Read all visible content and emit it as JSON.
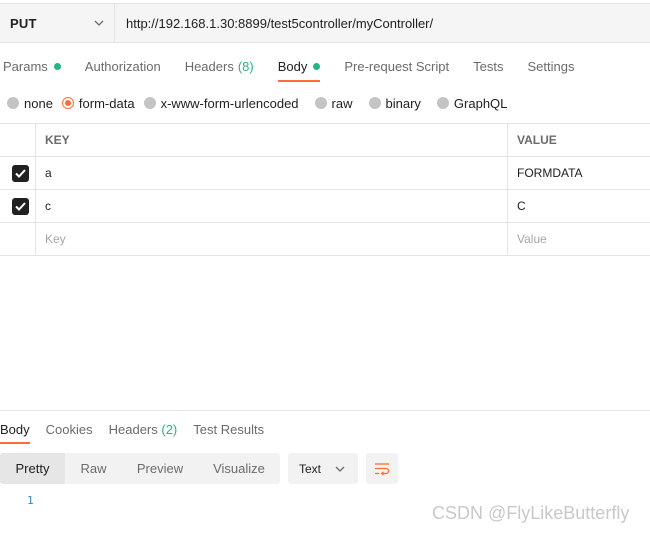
{
  "request": {
    "method": "PUT",
    "url": "http://192.168.1.30:8899/test5controller/myController/"
  },
  "tabs": [
    {
      "label": "Params",
      "dot": true
    },
    {
      "label": "Authorization"
    },
    {
      "label": "Headers",
      "count": "(8)"
    },
    {
      "label": "Body",
      "dot": true,
      "active": true
    },
    {
      "label": "Pre-request Script"
    },
    {
      "label": "Tests"
    },
    {
      "label": "Settings"
    }
  ],
  "body_types": [
    {
      "label": "none"
    },
    {
      "label": "form-data",
      "selected": true
    },
    {
      "label": "x-www-form-urlencoded"
    },
    {
      "label": "raw"
    },
    {
      "label": "binary"
    },
    {
      "label": "GraphQL"
    }
  ],
  "table": {
    "headers": {
      "key": "KEY",
      "value": "VALUE"
    },
    "rows": [
      {
        "key": "a",
        "value": "FORMDATA",
        "checked": true
      },
      {
        "key": "c",
        "value": "C",
        "checked": true
      }
    ],
    "placeholders": {
      "key": "Key",
      "value": "Value"
    }
  },
  "response": {
    "tabs": [
      {
        "label": "Body",
        "active": true
      },
      {
        "label": "Cookies"
      },
      {
        "label": "Headers",
        "count": "(2)"
      },
      {
        "label": "Test Results"
      }
    ],
    "views": [
      "Pretty",
      "Raw",
      "Preview",
      "Visualize"
    ],
    "active_view": "Pretty",
    "format": "Text",
    "line_number": "1"
  },
  "watermark": "CSDN @FlyLikeButterfly",
  "colors": {
    "accent": "#ff6c37",
    "status_green": "#26b47f"
  },
  "icons": {
    "method_dropdown": "chevron-down-icon",
    "wrap": "wrap-lines-icon",
    "check": "check-icon"
  }
}
